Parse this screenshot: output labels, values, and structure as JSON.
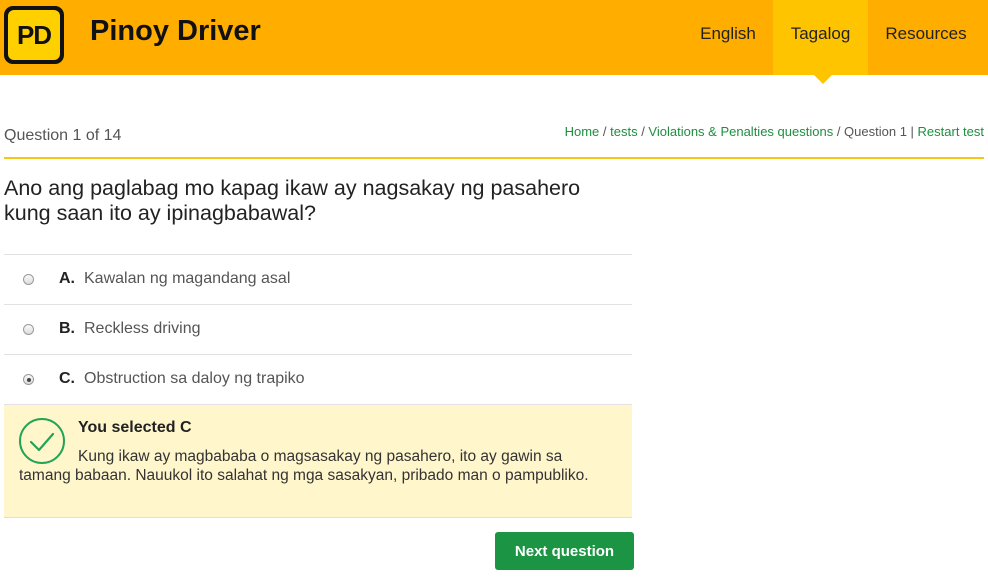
{
  "header": {
    "logo_text": "PD",
    "site_title": "Pinoy Driver",
    "nav": [
      {
        "label": "English"
      },
      {
        "label": "Tagalog",
        "active": true
      },
      {
        "label": "Resources"
      }
    ],
    "background_color": "#ffae00",
    "active_tab_color": "#ffc400"
  },
  "quiz": {
    "counter": "Question 1 of 14",
    "breadcrumb": {
      "home": "Home",
      "sep1": " / ",
      "tests": "tests",
      "sep2": " / ",
      "category": "Violations & Penalties questions",
      "sep3": " / ",
      "current": "Question 1",
      "sep4": " | ",
      "restart": "Restart test"
    },
    "question": "Ano ang paglabag mo kapag ikaw ay nagsakay ng pasahero kung saan ito ay ipinagbabawal?",
    "options": [
      {
        "letter": "A.",
        "text": "Kawalan ng magandang asal",
        "selected": false
      },
      {
        "letter": "B.",
        "text": "Reckless driving",
        "selected": false
      },
      {
        "letter": "C.",
        "text": "Obstruction sa daloy ng trapiko",
        "selected": true
      }
    ],
    "feedback": {
      "title": "You selected C",
      "text": "Kung ikaw ay magbababa o magsasakay ng pasahero, ito ay gawin sa tamang babaan. Nauukol ito salahat ng mga sasakyan, pribado man o pampubliko.",
      "icon": "checkmark-icon",
      "status_color": "#23a455"
    },
    "next_button": "Next question",
    "button_color": "#1b9444"
  }
}
